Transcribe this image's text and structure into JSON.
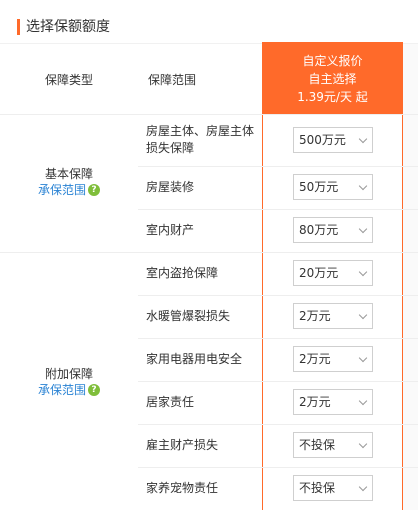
{
  "header": {
    "title": "选择保额额度"
  },
  "columns": {
    "type": "保障类型",
    "range": "保障范围"
  },
  "plan": {
    "line1": "自定义报价",
    "line2": "自主选择",
    "price": "1.39元/天 起"
  },
  "groups": [
    {
      "name": "基本保障",
      "link": "承保范围",
      "icon": "help-icon"
    },
    {
      "name": "附加保障",
      "link": "承保范围",
      "icon": "help-icon"
    }
  ],
  "rows": [
    {
      "label": "房屋主体、房屋主体损失保障",
      "value": "500万元"
    },
    {
      "label": "房屋装修",
      "value": "50万元"
    },
    {
      "label": "室内财产",
      "value": "80万元"
    },
    {
      "label": "室内盗抢保障",
      "value": "20万元"
    },
    {
      "label": "水暖管爆裂损失",
      "value": "2万元"
    },
    {
      "label": "家用电器用电安全",
      "value": "2万元"
    },
    {
      "label": "居家责任",
      "value": "2万元"
    },
    {
      "label": "雇主财产损失",
      "value": "不投保"
    },
    {
      "label": "家养宠物责任",
      "value": "不投保"
    }
  ],
  "colors": {
    "accent": "#ff6a2a",
    "link": "#2a83d4",
    "help": "#7fbe3a"
  }
}
